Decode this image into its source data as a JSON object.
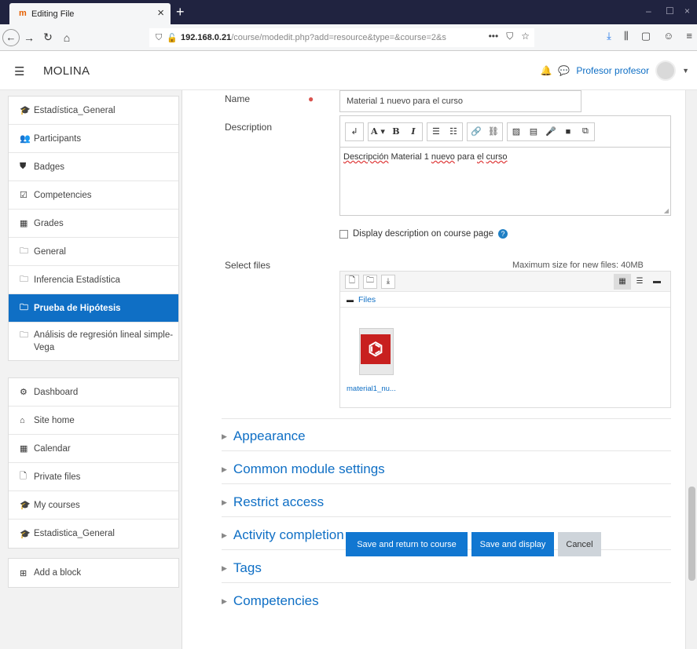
{
  "browser": {
    "tab_title": "Editing File",
    "tab_icon_glyph": "m",
    "url_host": "192.168.0.21",
    "url_path": "/course/modedit.php?add=resource&type=&course=2&s",
    "url_dots": "•••"
  },
  "header": {
    "brand": "MOLINA",
    "user_name": "Profesor profesor"
  },
  "sidebar": {
    "nav": [
      {
        "label": "Estadística_General",
        "icon": "graduation-cap-icon",
        "glyph": "🎓"
      },
      {
        "label": "Participants",
        "icon": "users-icon",
        "glyph": "👥"
      },
      {
        "label": "Badges",
        "icon": "shield-icon",
        "glyph": "⛊"
      },
      {
        "label": "Competencies",
        "icon": "checkbox-icon",
        "glyph": "☑"
      },
      {
        "label": "Grades",
        "icon": "table-icon",
        "glyph": "▦"
      },
      {
        "label": "General",
        "icon": "folder-icon",
        "glyph": "🗀"
      },
      {
        "label": "Inferencia Estadística",
        "icon": "folder-icon",
        "glyph": "🗀"
      },
      {
        "label": "Prueba de Hipótesis",
        "icon": "folder-icon",
        "glyph": "🗀",
        "active": true
      },
      {
        "label": "Análisis de regresión lineal simple-Vega",
        "icon": "folder-icon",
        "glyph": "🗀"
      }
    ],
    "nav2": [
      {
        "label": "Dashboard",
        "icon": "dashboard-icon",
        "glyph": "⚙"
      },
      {
        "label": "Site home",
        "icon": "home-icon",
        "glyph": "⌂"
      },
      {
        "label": "Calendar",
        "icon": "calendar-icon",
        "glyph": "▦"
      },
      {
        "label": "Private files",
        "icon": "file-icon",
        "glyph": "🗋"
      },
      {
        "label": "My courses",
        "icon": "graduation-cap-icon",
        "glyph": "🎓"
      },
      {
        "label": "Estadistica_General",
        "icon": "graduation-cap-icon",
        "glyph": "🎓"
      }
    ],
    "add_block": "Add a block"
  },
  "form": {
    "name_label": "Name",
    "name_value": "Material 1 nuevo para el curso",
    "description_label": "Description",
    "description_text_parts": [
      "Descripción",
      " Material 1 ",
      "nuevo",
      " para ",
      "el",
      " ",
      "curso"
    ],
    "toolbar": [
      "↲",
      "A ▾",
      "B",
      "I",
      "☰",
      "☷",
      "🔗",
      "⛓",
      "▨",
      "▤",
      "🎤",
      "■",
      "⧉"
    ],
    "display_desc_label": "Display description on course page",
    "select_files_label": "Select files",
    "max_size": "Maximum size for new files: 40MB",
    "fp_path_label": "Files",
    "file_name": "material1_nu...",
    "sections": [
      "Appearance",
      "Common module settings",
      "Restrict access",
      "Activity completion",
      "Tags",
      "Competencies"
    ],
    "btn_save_return": "Save and return to course",
    "btn_save_display": "Save and display",
    "btn_cancel": "Cancel"
  },
  "colors": {
    "accent": "#0f6fc5",
    "button": "#1177d1",
    "tabbar": "#202340",
    "required": "#d9534f",
    "pdf_red": "#c8201f"
  }
}
